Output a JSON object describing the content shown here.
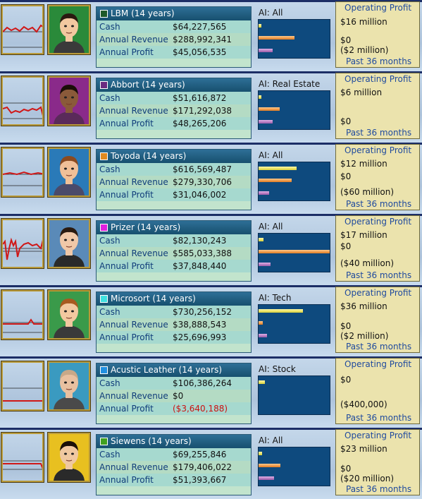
{
  "common": {
    "chart_title": "Operating Profit",
    "chart_footer": "Past 36 months",
    "label_cash": "Cash",
    "label_revenue": "Annual Revenue",
    "label_profit": "Annual Profit",
    "ai_prefix": "AI: "
  },
  "companies": [
    {
      "name": "LBM (14 years)",
      "color": "#1f5a2a",
      "cash": "$64,227,565",
      "revenue": "$288,992,341",
      "profit": "$45,056,535",
      "profit_negative": false,
      "ai": "All",
      "bars": {
        "cash": 0.04,
        "revenue": 0.5,
        "profit": 0.2
      },
      "chart": {
        "top": "$16 million",
        "zero": "$0",
        "bottom": "($2 million)"
      },
      "logo": "globe-stripes-logo",
      "portrait": "man-dark-hair-portrait"
    },
    {
      "name": "Abbort (14 years)",
      "color": "#6a2a80",
      "cash": "$51,616,872",
      "revenue": "$171,292,038",
      "profit": "$48,265,206",
      "profit_negative": false,
      "ai": "Real Estate",
      "bars": {
        "cash": 0.04,
        "revenue": 0.3,
        "profit": 0.2
      },
      "chart": {
        "top": "$6 million",
        "zero": "$0",
        "bottom": ""
      },
      "logo": "swirl-logo",
      "portrait": "woman-portrait"
    },
    {
      "name": "Toyoda (14 years)",
      "color": "#e08a20",
      "cash": "$616,569,487",
      "revenue": "$279,330,706",
      "profit": "$31,046,002",
      "profit_negative": false,
      "ai": "All",
      "bars": {
        "cash": 0.53,
        "revenue": 0.47,
        "profit": 0.15
      },
      "chart": {
        "top": "$12 million",
        "zero": "$0",
        "bottom": "($60 million)"
      },
      "logo": "bar-graph-logo",
      "portrait": "man-brown-hair-portrait"
    },
    {
      "name": "Prizer (14 years)",
      "color": "#e020e0",
      "cash": "$82,130,243",
      "revenue": "$585,033,388",
      "profit": "$37,848,440",
      "profit_negative": false,
      "ai": "All",
      "bars": {
        "cash": 0.07,
        "revenue": 1.0,
        "profit": 0.17
      },
      "chart": {
        "top": "$17 million",
        "zero": "$0",
        "bottom": "($40 million)"
      },
      "logo": "blue-globe-logo",
      "portrait": "man-suit-portrait"
    },
    {
      "name": "Microsort (14 years)",
      "color": "#40e0e0",
      "cash": "$730,256,152",
      "revenue": "$38,888,543",
      "profit": "$25,696,993",
      "profit_negative": false,
      "ai": "Tech",
      "bars": {
        "cash": 0.62,
        "revenue": 0.06,
        "profit": 0.12
      },
      "chart": {
        "top": "$36 million",
        "zero": "$0",
        "bottom": "($2 million)"
      },
      "logo": "leaf-logo",
      "portrait": "man-spiky-hair-portrait"
    },
    {
      "name": "Acustic Leather (14 years)",
      "color": "#2090e0",
      "cash": "$106,386,264",
      "revenue": "$0",
      "profit": "($3,640,188)",
      "profit_negative": true,
      "ai": "Stock",
      "bars": {
        "cash": 0.09,
        "revenue": 0.0,
        "profit": 0.0
      },
      "chart": {
        "top": "$0",
        "zero": "",
        "bottom": "($400,000)"
      },
      "logo": "ns-logo",
      "portrait": "man-bald-portrait"
    },
    {
      "name": "Siewens (14 years)",
      "color": "#40a020",
      "cash": "$69,255,846",
      "revenue": "$179,406,022",
      "profit": "$51,393,667",
      "profit_negative": false,
      "ai": "All",
      "bars": {
        "cash": 0.05,
        "revenue": 0.31,
        "profit": 0.22
      },
      "chart": {
        "top": "$23 million",
        "zero": "$0",
        "bottom": "($20 million)"
      },
      "logo": "spiral-shell-logo",
      "portrait": "woman-black-hair-portrait"
    }
  ]
}
